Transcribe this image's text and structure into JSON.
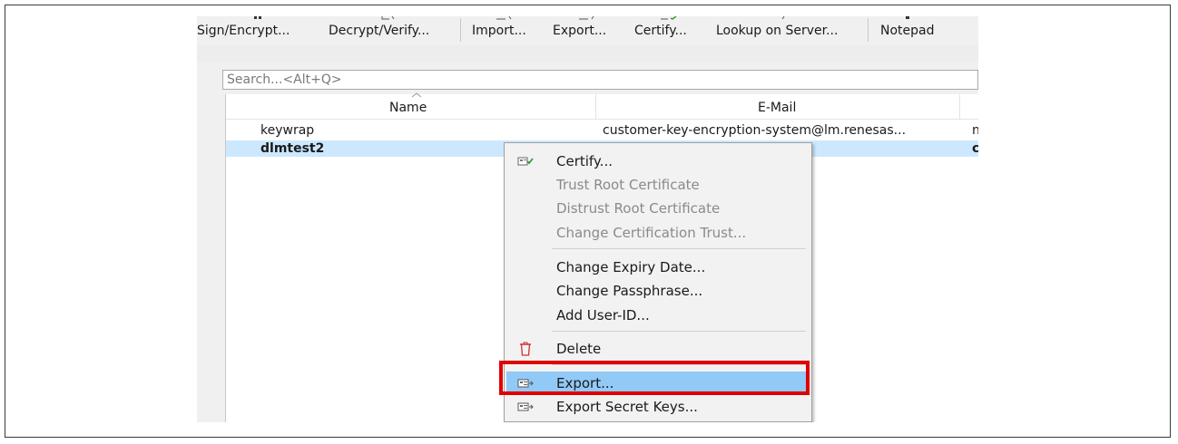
{
  "toolbar": {
    "buttons": [
      {
        "label": "Sign/Encrypt..."
      },
      {
        "label": "Decrypt/Verify..."
      },
      {
        "label": "Import..."
      },
      {
        "label": "Export..."
      },
      {
        "label": "Certify..."
      },
      {
        "label": "Lookup on Server..."
      },
      {
        "label": "Notepad"
      }
    ]
  },
  "search": {
    "placeholder": "Search...<Alt+Q>",
    "value": ""
  },
  "table": {
    "columns": [
      "Name",
      "E-Mail"
    ],
    "rows": [
      {
        "name": "keywrap",
        "email": "customer-key-encryption-system@lm.renesas...",
        "extra": "n",
        "selected": false
      },
      {
        "name": "dlmtest2",
        "email": "",
        "extra": "c",
        "selected": true
      }
    ]
  },
  "context_menu": {
    "items": [
      {
        "label": "Certify...",
        "icon": "certify-icon",
        "disabled": false
      },
      {
        "label": "Trust Root Certificate",
        "disabled": true
      },
      {
        "label": "Distrust Root Certificate",
        "disabled": true
      },
      {
        "label": "Change Certification Trust...",
        "disabled": true
      },
      {
        "label": "Change Expiry Date...",
        "disabled": false
      },
      {
        "label": "Change Passphrase...",
        "disabled": false
      },
      {
        "label": "Add User-ID...",
        "disabled": false
      },
      {
        "label": "Delete",
        "icon": "delete-icon",
        "disabled": false
      },
      {
        "label": "Export...",
        "icon": "export-icon",
        "disabled": false,
        "highlighted": true
      },
      {
        "label": "Export Secret Keys...",
        "icon": "export-secret-icon",
        "disabled": false
      }
    ]
  },
  "colors": {
    "selection": "#cce8ff",
    "menu_highlight": "#91c9f7",
    "callout": "#e00000"
  }
}
